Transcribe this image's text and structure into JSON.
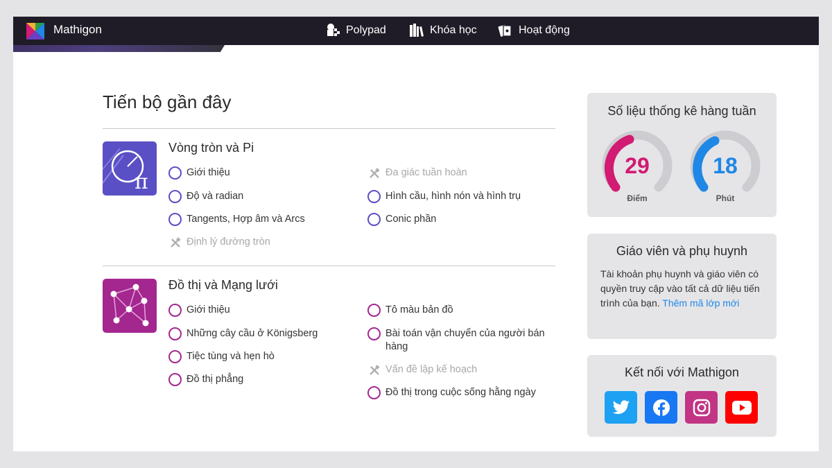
{
  "header": {
    "brand": "Mathigon",
    "nav": [
      {
        "label": "Polypad",
        "icon": "polypad-icon"
      },
      {
        "label": "Khóa học",
        "icon": "books-icon"
      },
      {
        "label": "Hoạt động",
        "icon": "cards-icon"
      }
    ]
  },
  "progress": {
    "title": "Tiến bộ gần đây",
    "courses": [
      {
        "title": "Vòng tròn và Pi",
        "color": "#5a4fc4",
        "left_lessons": [
          {
            "label": "Giới thiệu",
            "status": "open"
          },
          {
            "label": "Độ và radian",
            "status": "open"
          },
          {
            "label": "Tangents, Hợp âm và Arcs",
            "status": "open"
          },
          {
            "label": "Định lý đường tròn",
            "status": "disabled"
          }
        ],
        "right_lessons": [
          {
            "label": "Đa giác tuần hoàn",
            "status": "disabled"
          },
          {
            "label": "Hình cầu, hình nón và hình trụ",
            "status": "open"
          },
          {
            "label": "Conic phần",
            "status": "open"
          }
        ]
      },
      {
        "title": "Đồ thị và Mạng lưới",
        "color": "#a3278f",
        "left_lessons": [
          {
            "label": "Giới thiệu",
            "status": "open"
          },
          {
            "label": "Những cây cầu ở Königsberg",
            "status": "open"
          },
          {
            "label": "Tiệc tùng và hẹn hò",
            "status": "open"
          },
          {
            "label": "Đồ thị phẳng",
            "status": "open"
          }
        ],
        "right_lessons": [
          {
            "label": "Tô màu bản đồ",
            "status": "open"
          },
          {
            "label": "Bài toán vận chuyển của người bán hàng",
            "status": "open"
          },
          {
            "label": "Vấn đề lập kế hoạch",
            "status": "disabled"
          },
          {
            "label": "Đồ thị trong cuộc sống hằng ngày",
            "status": "open"
          }
        ]
      }
    ]
  },
  "weekly_stats": {
    "title": "Số liệu thống kê hàng tuần",
    "points": {
      "value": "29",
      "label": "Điểm",
      "color": "#d21b72"
    },
    "minutes": {
      "value": "18",
      "label": "Phút",
      "color": "#1f87e5"
    }
  },
  "teachers": {
    "title": "Giáo viên và phụ huynh",
    "text": "Tài khoản phụ huynh và giáo viên có quyền truy cập vào tất cả dữ liệu tiến trình của bạn.",
    "link": "Thêm mã lớp mới"
  },
  "connect": {
    "title": "Kết nối với Mathigon",
    "networks": [
      {
        "name": "twitter-icon",
        "color": "#1da1f2"
      },
      {
        "name": "facebook-icon",
        "color": "#1877f2"
      },
      {
        "name": "instagram-icon",
        "color": "#c13584"
      },
      {
        "name": "youtube-icon",
        "color": "#ff0000"
      }
    ]
  }
}
